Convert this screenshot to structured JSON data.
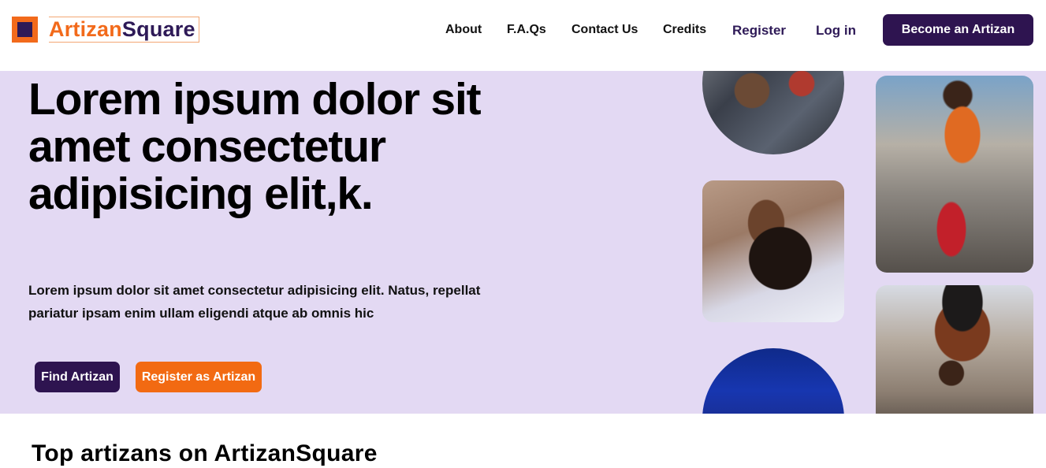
{
  "brand": {
    "name_part1": "Artizan",
    "name_part2": "Square",
    "colors": {
      "orange": "#f26a1b",
      "purple": "#2e1450",
      "hero_bg": "#e3d9f3"
    }
  },
  "nav": {
    "about": "About",
    "faqs": "F.A.Qs",
    "contact": "Contact Us",
    "credits": "Credits",
    "register": "Register",
    "login": "Log in",
    "become": "Become an Artizan"
  },
  "hero": {
    "title": "Lorem ipsum dolor sit amet consectetur adipisicing elit,k.",
    "subtitle": "Lorem ipsum dolor sit amet consectetur adipisicing elit. Natus, repellat pariatur ipsam enim ullam eligendi atque ab omnis hic",
    "find_button": "Find Artizan",
    "register_button": "Register as Artizan"
  },
  "sections": {
    "top_artizans_title": "Top artizans on ArtizanSquare"
  }
}
